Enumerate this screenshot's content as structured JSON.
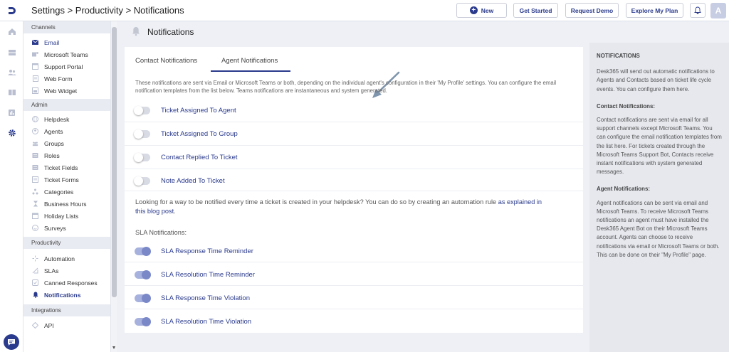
{
  "breadcrumb": "Settings > Productivity > Notifications",
  "topbar": {
    "new_label": "New",
    "get_started_label": "Get Started",
    "request_demo_label": "Request Demo",
    "explore_plan_label": "Explore My Plan",
    "avatar_initial": "A"
  },
  "sidebar": {
    "channels_heading": "Channels",
    "channels": [
      {
        "label": "Email",
        "icon": "envelope-icon"
      },
      {
        "label": "Microsoft Teams",
        "icon": "teams-icon"
      },
      {
        "label": "Support Portal",
        "icon": "portal-icon"
      },
      {
        "label": "Web Form",
        "icon": "form-icon"
      },
      {
        "label": "Web Widget",
        "icon": "widget-icon"
      }
    ],
    "admin_heading": "Admin",
    "admin": [
      {
        "label": "Helpdesk",
        "icon": "globe-icon"
      },
      {
        "label": "Agents",
        "icon": "agent-icon"
      },
      {
        "label": "Groups",
        "icon": "groups-icon"
      },
      {
        "label": "Roles",
        "icon": "roles-icon"
      },
      {
        "label": "Ticket Fields",
        "icon": "fields-icon"
      },
      {
        "label": "Ticket Forms",
        "icon": "forms-icon"
      },
      {
        "label": "Categories",
        "icon": "categories-icon"
      },
      {
        "label": "Business Hours",
        "icon": "hourglass-icon"
      },
      {
        "label": "Holiday Lists",
        "icon": "calendar-icon"
      },
      {
        "label": "Surveys",
        "icon": "smiley-icon"
      }
    ],
    "productivity_heading": "Productivity",
    "productivity": [
      {
        "label": "Automation",
        "icon": "automation-icon"
      },
      {
        "label": "SLAs",
        "icon": "sla-icon"
      },
      {
        "label": "Canned Responses",
        "icon": "canned-icon"
      },
      {
        "label": "Notifications",
        "icon": "bell-icon"
      }
    ],
    "integrations_heading": "Integrations",
    "integrations": [
      {
        "label": "API",
        "icon": "api-icon"
      }
    ]
  },
  "page": {
    "title": "Notifications",
    "tabs": [
      "Contact Notifications",
      "Agent Notifications"
    ],
    "active_tab": "Agent Notifications",
    "description": "These notifications are sent via Email or Microsoft Teams or both, depending on the individual agent's configuration in their 'My Profile' settings. You can configure the email notification templates from the list below. Teams notifications are instantaneous and system generated.",
    "notifications": [
      {
        "label": "Ticket Assigned To Agent",
        "enabled": false
      },
      {
        "label": "Ticket Assigned To Group",
        "enabled": false
      },
      {
        "label": "Contact Replied To Ticket",
        "enabled": false
      },
      {
        "label": "Note Added To Ticket",
        "enabled": false
      }
    ],
    "help_text": "Looking for a way to be notified every time a ticket is created in your helpdesk? You can do so by creating an automation rule",
    "help_link": "as explained in this blog post",
    "help_end": ".",
    "sla_heading": "SLA Notifications:",
    "sla": [
      {
        "label": "SLA Response Time Reminder",
        "enabled": true
      },
      {
        "label": "SLA Resolution Time Reminder",
        "enabled": true
      },
      {
        "label": "SLA Response Time Violation",
        "enabled": true
      },
      {
        "label": "SLA Resolution Time Violation",
        "enabled": true
      }
    ]
  },
  "help_panel": {
    "heading": "NOTIFICATIONS",
    "intro": "Desk365 will send out automatic notifications to Agents and Contacts based on ticket life cycle events. You can configure them here.",
    "contact_heading": "Contact Notifications:",
    "contact_text": "Contact notifications are sent via email for all support channels except Microsoft Teams. You can configure the email notification templates from the list here. For tickets created through the Microsoft Teams Support Bot, Contacts receive instant notifications with system generated messages.",
    "agent_heading": "Agent Notifications:",
    "agent_text": "Agent notifications can be sent via email and Microsoft Teams. To receive Microsoft Teams notifications an agent must have installed the Desk365 Agent Bot on their Microsoft Teams account. Agents can choose to receive notifications via email or Microsoft Teams or both. This can be done on their \"My Profile\" page."
  },
  "colors": {
    "brand": "#2a3a8c",
    "toggle_on": "#7b88c8",
    "toggle_off": "#d8dbe3",
    "panel_bg": "#e6e8ee"
  }
}
